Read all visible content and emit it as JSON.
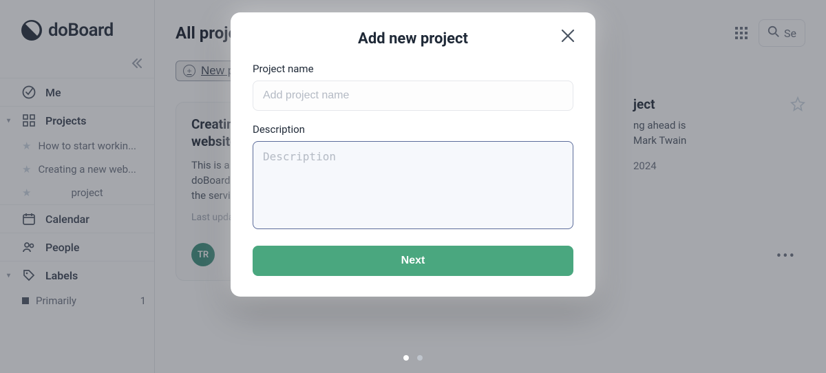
{
  "brand": {
    "name": "doBoard"
  },
  "sidebar": {
    "me": "Me",
    "projects": "Projects",
    "project_items": [
      "How to start workin...",
      "Creating a new web...",
      "project"
    ],
    "calendar": "Calendar",
    "people": "People",
    "labels": "Labels",
    "label_items": [
      {
        "name": "Primarily",
        "count": "1"
      }
    ]
  },
  "main": {
    "title": "All projects",
    "new_project": "New project",
    "search_placeholder": "Se"
  },
  "cards": [
    {
      "title": "Creating a new website(Example)",
      "desc": "This is a small example of using doBoard to familiarize yourself with the service's capabilities.",
      "meta": "Last update",
      "avatar": "TR"
    }
  ],
  "card_right": {
    "title_suffix": "ject",
    "desc_line1": "ng ahead is",
    "desc_line2": "Mark Twain",
    "date": "2024"
  },
  "modal": {
    "title": "Add new project",
    "name_label": "Project name",
    "name_placeholder": "Add project name",
    "desc_label": "Description",
    "desc_placeholder": "Description",
    "next": "Next"
  }
}
